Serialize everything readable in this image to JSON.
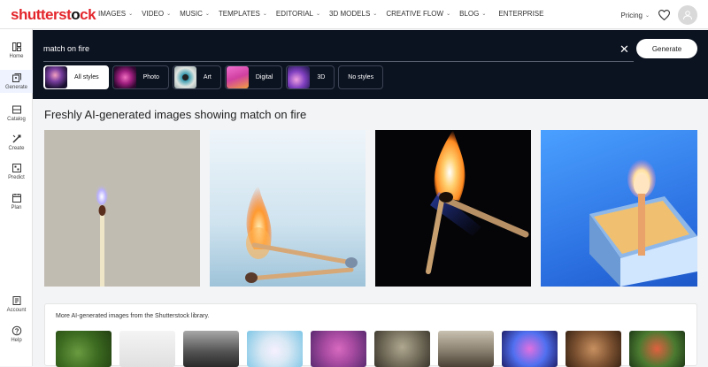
{
  "brand": {
    "logo_text_red": "shutterst",
    "logo_text_dark": "ck",
    "logo_o": "o"
  },
  "nav": [
    {
      "label": "IMAGES",
      "chevron": true
    },
    {
      "label": "VIDEO",
      "chevron": true
    },
    {
      "label": "MUSIC",
      "chevron": true
    },
    {
      "label": "TEMPLATES",
      "chevron": true
    },
    {
      "label": "EDITORIAL",
      "chevron": true
    },
    {
      "label": "3D MODELS",
      "chevron": true
    },
    {
      "label": "CREATIVE FLOW",
      "chevron": true
    },
    {
      "label": "BLOG",
      "chevron": true
    },
    {
      "label": "ENTERPRISE",
      "chevron": false
    }
  ],
  "topright": {
    "pricing_label": "Pricing"
  },
  "sidebar": {
    "items": [
      {
        "label": "Home",
        "icon": "home-icon"
      },
      {
        "label": "Generate",
        "icon": "generate-icon"
      },
      {
        "label": "Catalog",
        "icon": "catalog-icon"
      },
      {
        "label": "Create",
        "icon": "create-icon"
      },
      {
        "label": "Predict",
        "icon": "predict-icon"
      },
      {
        "label": "Plan",
        "icon": "plan-icon"
      },
      {
        "label": "Account",
        "icon": "account-icon"
      },
      {
        "label": "Help",
        "icon": "help-icon"
      }
    ]
  },
  "search": {
    "query": "match on fire",
    "generate_label": "Generate"
  },
  "styles": [
    {
      "label": "All styles"
    },
    {
      "label": "Photo"
    },
    {
      "label": "Art"
    },
    {
      "label": "Digital"
    },
    {
      "label": "3D"
    },
    {
      "label": "No styles"
    }
  ],
  "results": {
    "heading": "Freshly AI-generated images showing match on fire"
  },
  "library": {
    "title": "More AI-generated images from the Shutterstock library."
  },
  "colors": {
    "brand_red": "#e3262c",
    "search_bg": "#0b1220",
    "page_bg": "#f3f4f6"
  }
}
